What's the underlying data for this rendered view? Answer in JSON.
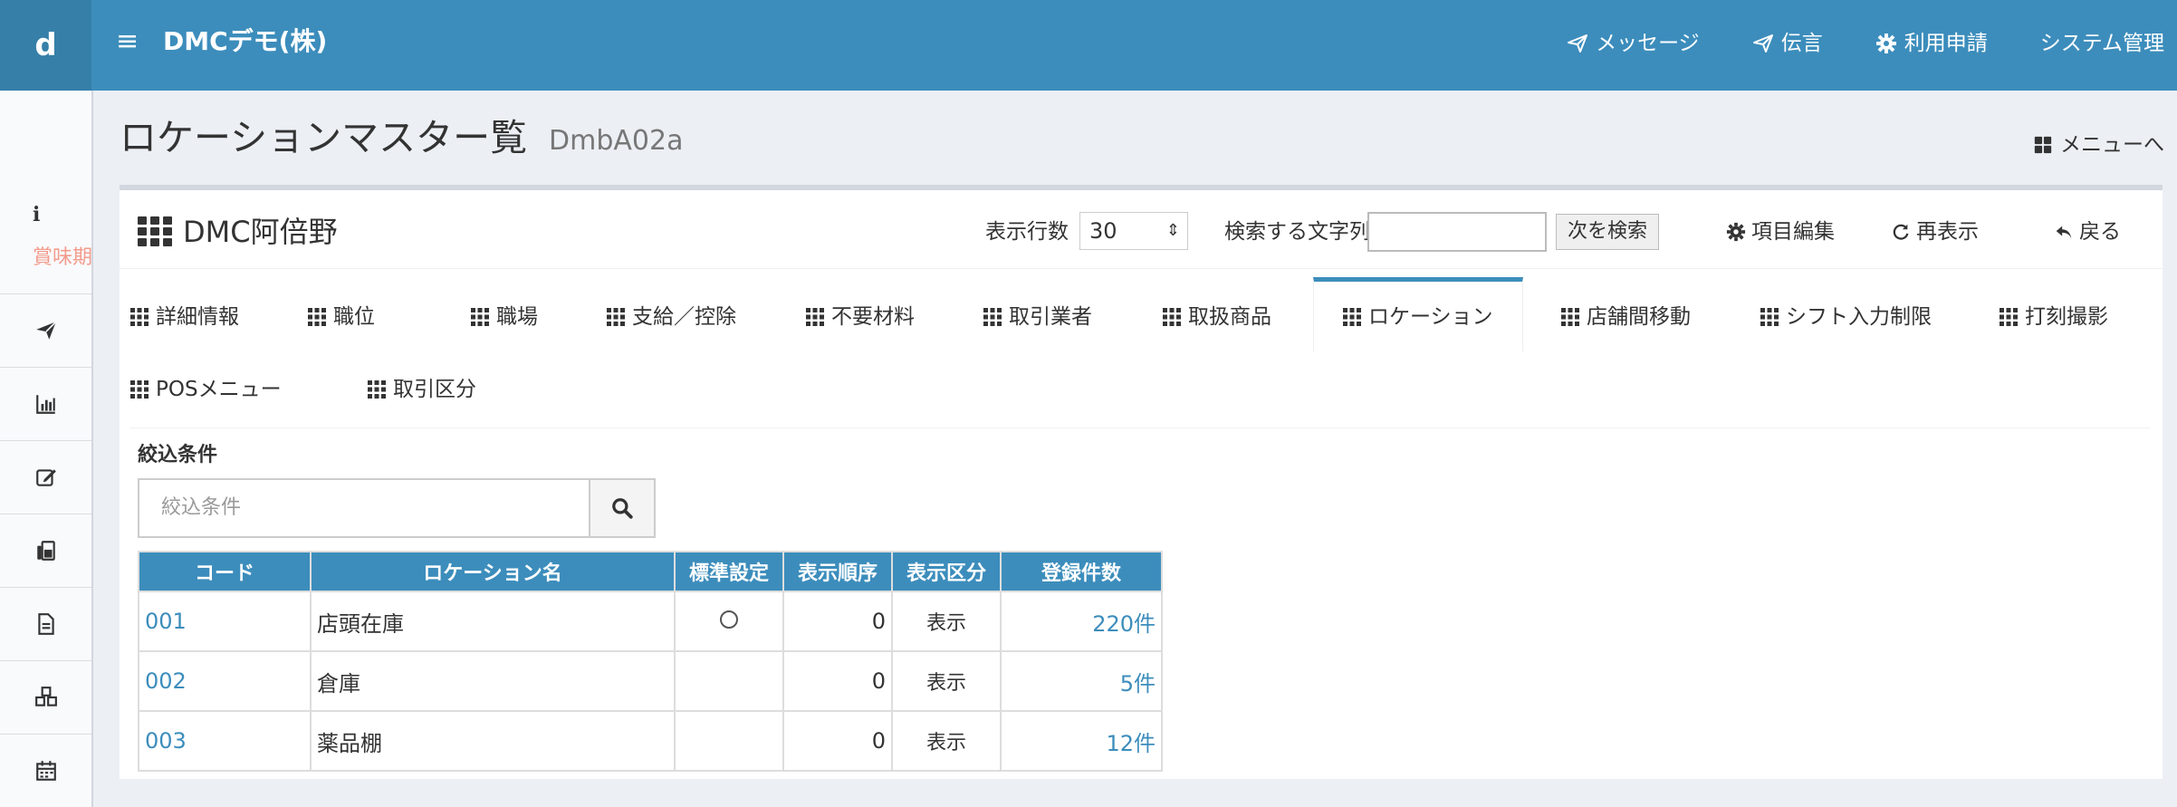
{
  "header": {
    "logo": "d",
    "company": "DMCデモ(株)",
    "nav": [
      {
        "label": "メッセージ",
        "icon": "paper-plane-icon"
      },
      {
        "label": "伝言",
        "icon": "paper-plane-icon"
      },
      {
        "label": "利用申請",
        "icon": "gear-icon"
      },
      {
        "label": "システム管理",
        "icon": ""
      }
    ]
  },
  "sidebar": {
    "info_label": "賞味期",
    "items": [
      "send-icon",
      "bar-chart-icon",
      "edit-icon",
      "fax-icon",
      "document-icon",
      "cubes-icon",
      "calendar-icon"
    ]
  },
  "page": {
    "title": "ロケーションマスター覧",
    "subtitle": "DmbA02a",
    "menu_link": "メニューへ"
  },
  "box": {
    "title": "DMC阿倍野",
    "rows_label": "表示行数",
    "rows_value": "30",
    "search_label": "検索する文字列",
    "search_value": "",
    "next_search": "次を検索",
    "edit_items": "項目編集",
    "refresh": "再表示",
    "back": "戻る"
  },
  "tabs": [
    {
      "label": "詳細情報"
    },
    {
      "label": "職位"
    },
    {
      "label": "職場"
    },
    {
      "label": "支給／控除"
    },
    {
      "label": "不要材料"
    },
    {
      "label": "取引業者"
    },
    {
      "label": "取扱商品"
    },
    {
      "label": "ロケーション",
      "active": true
    },
    {
      "label": "店舗間移動"
    },
    {
      "label": "シフト入力制限"
    },
    {
      "label": "打刻撮影"
    },
    {
      "label": "POSメニュー"
    },
    {
      "label": "取引区分"
    }
  ],
  "filter": {
    "label": "絞込条件",
    "placeholder": "絞込条件"
  },
  "table": {
    "columns": [
      "コード",
      "ロケーション名",
      "標準設定",
      "表示順序",
      "表示区分",
      "登録件数"
    ],
    "rows": [
      {
        "code": "001",
        "name": "店頭在庫",
        "standard": true,
        "order": "0",
        "division": "表示",
        "count": "220件"
      },
      {
        "code": "002",
        "name": "倉庫",
        "standard": false,
        "order": "0",
        "division": "表示",
        "count": "5件"
      },
      {
        "code": "003",
        "name": "薬品棚",
        "standard": false,
        "order": "0",
        "division": "表示",
        "count": "12件"
      }
    ]
  },
  "colors": {
    "header": "#3c8dbc",
    "logo_bg": "#367fa9",
    "link": "#3c8dbc",
    "expiry_text": "#f39c8d"
  }
}
